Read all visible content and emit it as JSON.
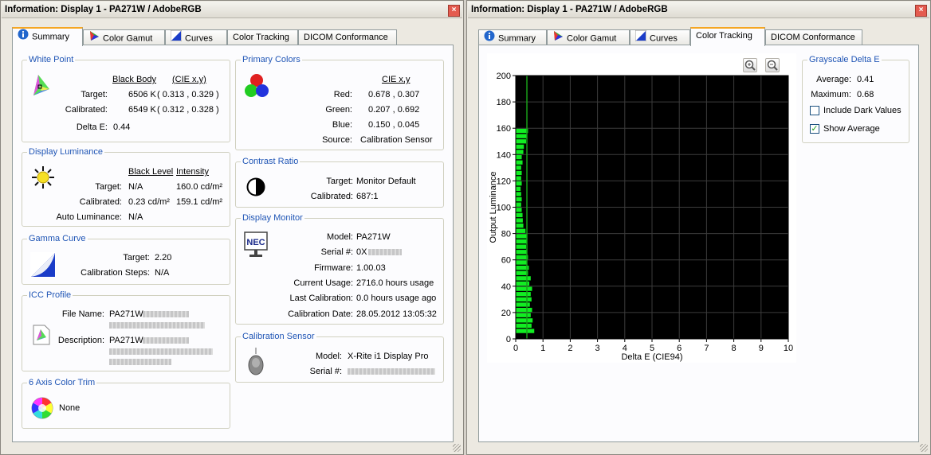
{
  "left_window": {
    "title": "Information: Display 1 - PA271W / AdobeRGB",
    "close": "×",
    "tabs": [
      "Summary",
      "Color Gamut",
      "Curves",
      "Color Tracking",
      "DICOM Conformance"
    ],
    "active_tab": "Summary",
    "white_point": {
      "title": "White Point",
      "col1": "Black Body",
      "col2": "(CIE x,y)",
      "target_label": "Target:",
      "target_bb": "6506 K",
      "target_xy": "( 0.313 , 0.329 )",
      "calibrated_label": "Calibrated:",
      "calibrated_bb": "6549 K",
      "calibrated_xy": "( 0.312 , 0.328 )",
      "delta_label": "Delta E:",
      "delta_value": "0.44"
    },
    "display_luminance": {
      "title": "Display Luminance",
      "col1": "Black Level",
      "col2": "Intensity",
      "target_label": "Target:",
      "target_black": "N/A",
      "target_intensity": "160.0 cd/m²",
      "calibrated_label": "Calibrated:",
      "calibrated_black": "0.23 cd/m²",
      "calibrated_intensity": "159.1 cd/m²",
      "auto_label": "Auto Luminance:",
      "auto_value": "N/A"
    },
    "gamma_curve": {
      "title": "Gamma Curve",
      "target_label": "Target:",
      "target_value": "2.20",
      "steps_label": "Calibration Steps:",
      "steps_value": "N/A"
    },
    "icc_profile": {
      "title": "ICC Profile",
      "filename_label": "File Name:",
      "filename_value": "PA271W",
      "description_label": "Description:",
      "description_value": "PA271W"
    },
    "six_axis": {
      "title": "6 Axis Color Trim",
      "value": "None"
    },
    "primary_colors": {
      "title": "Primary Colors",
      "col": "CIE x,y",
      "red_label": "Red:",
      "red_value": "0.678 , 0.307",
      "green_label": "Green:",
      "green_value": "0.207 , 0.692",
      "blue_label": "Blue:",
      "blue_value": "0.150 , 0.045",
      "source_label": "Source:",
      "source_value": "Calibration Sensor"
    },
    "contrast_ratio": {
      "title": "Contrast Ratio",
      "target_label": "Target:",
      "target_value": "Monitor Default",
      "calibrated_label": "Calibrated:",
      "calibrated_value": "687:1"
    },
    "display_monitor": {
      "title": "Display Monitor",
      "logo": "NEC",
      "model_label": "Model:",
      "model_value": "PA271W",
      "serial_label": "Serial #:",
      "serial_value": "0X",
      "firmware_label": "Firmware:",
      "firmware_value": "1.00.03",
      "usage_label": "Current Usage:",
      "usage_value": "2716.0 hours usage",
      "lastcal_label": "Last Calibration:",
      "lastcal_value": "0.0 hours usage ago",
      "caldate_label": "Calibration Date:",
      "caldate_value": "28.05.2012 13:05:32"
    },
    "calibration_sensor": {
      "title": "Calibration Sensor",
      "model_label": "Model:",
      "model_value": "X-Rite i1 Display Pro",
      "serial_label": "Serial #:"
    }
  },
  "right_window": {
    "title": "Information: Display 1 - PA271W / AdobeRGB",
    "close": "×",
    "tabs": [
      "Summary",
      "Color Gamut",
      "Curves",
      "Color Tracking",
      "DICOM Conformance"
    ],
    "active_tab": "Color Tracking",
    "zoom_in_icon": "zoom-in-icon",
    "zoom_out_icon": "zoom-out-icon",
    "grayscale": {
      "title": "Grayscale Delta E",
      "average_label": "Average:",
      "average_value": "0.41",
      "maximum_label": "Maximum:",
      "maximum_value": "0.68",
      "include_dark_label": "Include Dark Values",
      "include_dark_checked": false,
      "show_average_label": "Show Average",
      "show_average_checked": true
    }
  },
  "chart_data": {
    "type": "bar",
    "orientation": "horizontal",
    "xlabel": "Delta E (CIE94)",
    "ylabel": "Output Luminance",
    "xlim": [
      0,
      10
    ],
    "ylim": [
      0,
      200
    ],
    "xticks": [
      0,
      1,
      2,
      3,
      4,
      5,
      6,
      7,
      8,
      9,
      10
    ],
    "yticks": [
      0,
      20,
      40,
      60,
      80,
      100,
      120,
      140,
      160,
      180,
      200
    ],
    "average_line": 0.41,
    "bar_color": "#11ee22",
    "background": "#000000",
    "grid_color": "#3c3c3c",
    "bars": [
      {
        "y": 6,
        "x": 0.68
      },
      {
        "y": 10,
        "x": 0.58
      },
      {
        "y": 14,
        "x": 0.62
      },
      {
        "y": 18,
        "x": 0.55
      },
      {
        "y": 22,
        "x": 0.6
      },
      {
        "y": 26,
        "x": 0.52
      },
      {
        "y": 30,
        "x": 0.58
      },
      {
        "y": 34,
        "x": 0.55
      },
      {
        "y": 38,
        "x": 0.6
      },
      {
        "y": 42,
        "x": 0.5
      },
      {
        "y": 46,
        "x": 0.55
      },
      {
        "y": 50,
        "x": 0.45
      },
      {
        "y": 54,
        "x": 0.48
      },
      {
        "y": 58,
        "x": 0.42
      },
      {
        "y": 62,
        "x": 0.45
      },
      {
        "y": 66,
        "x": 0.4
      },
      {
        "y": 70,
        "x": 0.38
      },
      {
        "y": 74,
        "x": 0.42
      },
      {
        "y": 78,
        "x": 0.4
      },
      {
        "y": 82,
        "x": 0.36
      },
      {
        "y": 86,
        "x": 0.28
      },
      {
        "y": 90,
        "x": 0.26
      },
      {
        "y": 94,
        "x": 0.25
      },
      {
        "y": 98,
        "x": 0.22
      },
      {
        "y": 102,
        "x": 0.2
      },
      {
        "y": 106,
        "x": 0.22
      },
      {
        "y": 110,
        "x": 0.2
      },
      {
        "y": 114,
        "x": 0.18
      },
      {
        "y": 118,
        "x": 0.22
      },
      {
        "y": 122,
        "x": 0.2
      },
      {
        "y": 126,
        "x": 0.22
      },
      {
        "y": 130,
        "x": 0.2
      },
      {
        "y": 134,
        "x": 0.25
      },
      {
        "y": 138,
        "x": 0.22
      },
      {
        "y": 142,
        "x": 0.28
      },
      {
        "y": 146,
        "x": 0.3
      },
      {
        "y": 150,
        "x": 0.38
      },
      {
        "y": 154,
        "x": 0.42
      },
      {
        "y": 158,
        "x": 0.45
      }
    ]
  }
}
